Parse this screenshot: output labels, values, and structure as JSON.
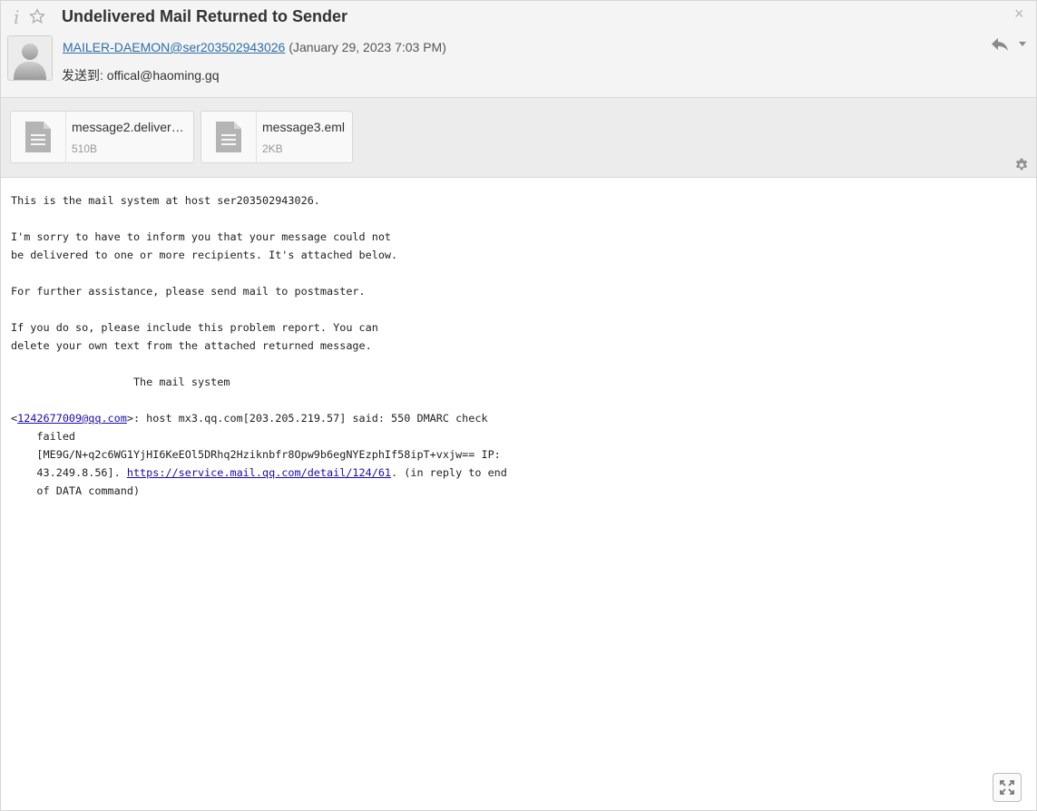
{
  "header": {
    "subject": "Undelivered Mail Returned to Sender",
    "info_glyph": "i",
    "from_address": "MAILER-DAEMON@ser203502943026",
    "date": "(January 29, 2023 7:03 PM)",
    "to_label": "发送到:",
    "to_address": "offical@haoming.gq",
    "close_glyph": "×",
    "icons": [
      "info-icon",
      "star-icon",
      "avatar",
      "reply-icon",
      "chevron-down-icon",
      "close-icon"
    ]
  },
  "attachments": [
    {
      "name": "message2.deliver…",
      "size": "510B",
      "icon": "document-icon"
    },
    {
      "name": "message3.eml",
      "size": "2KB",
      "icon": "document-icon"
    }
  ],
  "body": {
    "p1": "This is the mail system at host ser203502943026.\n\nI'm sorry to have to inform you that your message could not\nbe delivered to one or more recipients. It's attached below.\n\nFor further assistance, please send mail to postmaster.\n\nIf you do so, please include this problem report. You can\ndelete your own text from the attached returned message.\n\n                   The mail system\n\n<",
    "recipient_link": "1242677009@qq.com",
    "p2": ">: host mx3.qq.com[203.205.219.57] said: 550 DMARC check\n    failed\n    [ME9G/N+q2c6WG1YjHI6KeEOl5DRhq2Hziknbfr8Opw9b6egNYEzphIf58ipT+vxjw== IP:\n    43.249.8.56]. ",
    "service_link": "https://service.mail.qq.com/detail/124/61",
    "p3": ". (in reply to end\n    of DATA command)"
  },
  "colors": {
    "link": "#2f6fa7",
    "header_bg": "#f4f4f4",
    "attach_bg": "#ececec"
  }
}
